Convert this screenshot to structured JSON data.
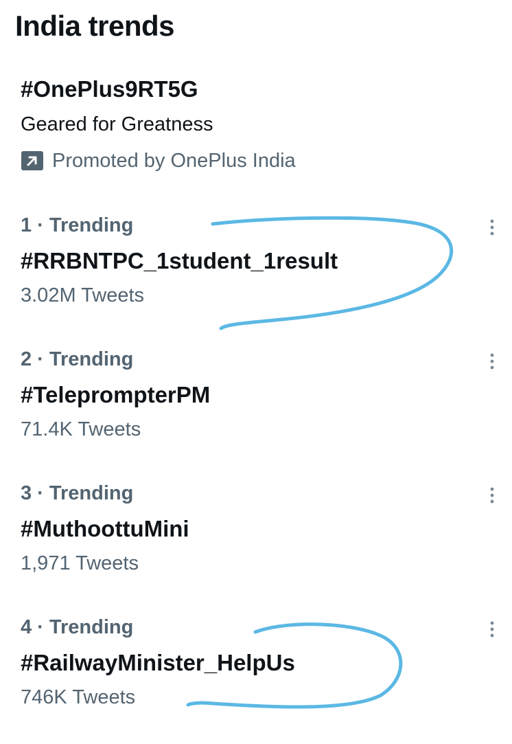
{
  "header": {
    "title": "India trends"
  },
  "promoted": {
    "hashtag": "#OnePlus9RT5G",
    "description": "Geared for Greatness",
    "promoted_by": "Promoted by OnePlus India",
    "icon": "promoted-arrow-icon"
  },
  "trends": [
    {
      "meta": "1 · Trending",
      "name": "#RRBNTPC_1student_1result",
      "count": "3.02M Tweets"
    },
    {
      "meta": "2 · Trending",
      "name": "#TeleprompterPM",
      "count": "71.4K Tweets"
    },
    {
      "meta": "3 · Trending",
      "name": "#MuthoottuMini",
      "count": "1,971 Tweets"
    },
    {
      "meta": "4 · Trending",
      "name": "#RailwayMinister_HelpUs",
      "count": "746K Tweets"
    }
  ],
  "colors": {
    "text_primary": "#0f1419",
    "text_secondary": "#536471",
    "annotation_stroke": "#5bb8e4",
    "promo_icon_bg": "#536471"
  }
}
